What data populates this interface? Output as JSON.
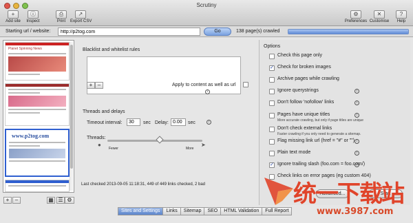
{
  "window": {
    "title": "Scrutiny"
  },
  "toolbar": {
    "add_site": "Add site",
    "inspect": "Inspect",
    "print": "Print",
    "export_csv": "Export CSV",
    "preferences": "Preferences",
    "customise": "Customise",
    "help": "Help"
  },
  "urlbar": {
    "label": "Starting url / website:",
    "url": "http://p2tog.com",
    "go": "Go",
    "crawled": "138 page(s) crawled",
    "progress_fraction": 1.0
  },
  "sidebar": {
    "thumbs": [
      {
        "title": "Planet Spinning News"
      },
      {
        "title": ""
      },
      {
        "title": "www.p2tog.com"
      },
      {
        "title": ""
      }
    ]
  },
  "blacklist": {
    "heading": "Blacklist and whitelist rules",
    "apply_label": "Apply to content as well as url",
    "apply_checked": false
  },
  "threads": {
    "heading": "Threads and delays",
    "timeout_label": "Timeout interval:",
    "timeout_value": "30",
    "timeout_unit": "sec",
    "delay_label": "Delay:",
    "delay_value": "0.00",
    "delay_unit": "sec",
    "threads_label": "Threads:",
    "fewer": "Fewer",
    "more": "More",
    "slider_value": 0.55
  },
  "status": "Last checked 2013-09-05 11:18:31, 449 of 449 links checked, 2 bad",
  "options": {
    "heading": "Options",
    "items": [
      {
        "label": "Check this page only",
        "checked": false
      },
      {
        "label": "Check for broken images",
        "checked": true
      },
      {
        "label": "Archive pages while crawling",
        "checked": false
      },
      {
        "label": "Ignore querystrings",
        "checked": false
      },
      {
        "label": "Don't follow 'nofollow' links",
        "checked": false
      },
      {
        "label": "Pages have unique titles",
        "checked": false,
        "sub": "More accurate crawling, but only if page titles are unique"
      },
      {
        "label": "Don't check external links",
        "checked": false,
        "sub": "Faster crawling if you only need to generate a sitemap."
      },
      {
        "label": "Flag missing link url (href = \"#\"  or  \"\")",
        "checked": false
      },
      {
        "label": "Plain text mode",
        "checked": false
      },
      {
        "label": "Ignore trailing slash (foo.com = foo.com/)",
        "checked": true
      },
      {
        "label": "Check links on error pages (eg custom 404)",
        "checked": false
      }
    ],
    "advanced": "Advanced...",
    "start": "Start"
  },
  "tabs": [
    "Sites and Settings",
    "Links",
    "Sitemap",
    "SEO",
    "HTML Validation",
    "Full Report"
  ],
  "active_tab": 0,
  "watermark": {
    "text": "统一下载站",
    "url": "www.3987.com"
  }
}
